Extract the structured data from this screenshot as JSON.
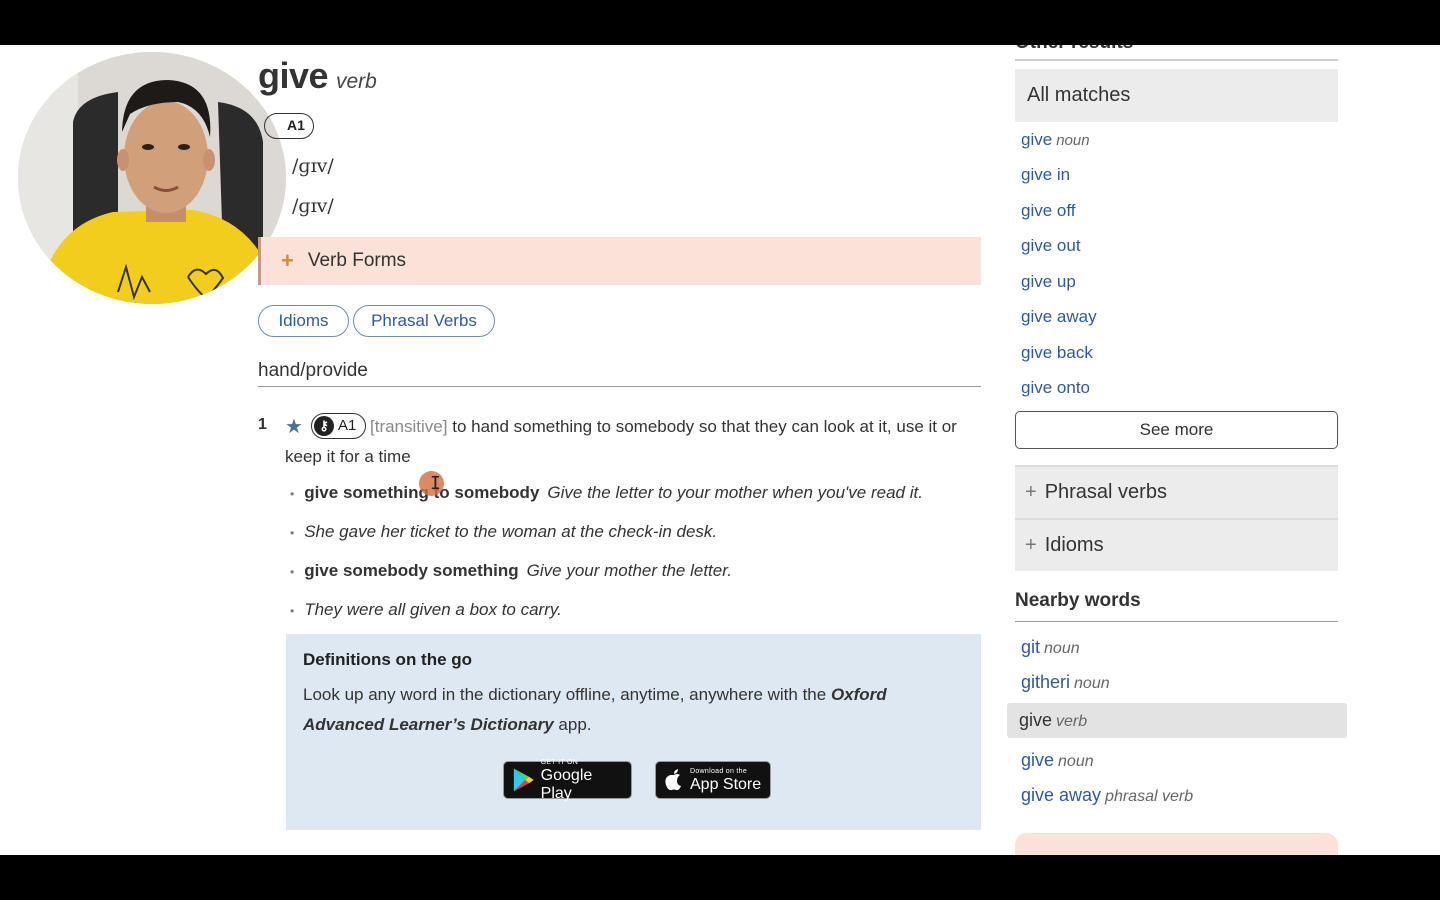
{
  "entry": {
    "headword": "give",
    "pos": "verb",
    "cefr": "A1",
    "phonetic_uk": "/ɡɪv/",
    "phonetic_us": "/ɡɪv/",
    "verb_forms_label": "Verb Forms",
    "tabs": [
      "Idioms",
      "Phrasal Verbs"
    ],
    "sense_heading": "hand/provide",
    "definition": {
      "number": "1",
      "cefr": "A1",
      "grammar": "[transitive]",
      "text": "to hand something to somebody so that they can look at it, use it or keep it for a time"
    },
    "examples": [
      {
        "collocation": "give something to somebody",
        "sentence": "Give the letter to your mother when you've read it."
      },
      {
        "collocation": "",
        "sentence": "She gave her ticket to the woman at the check-in desk."
      },
      {
        "collocation": "give somebody something",
        "sentence": "Give your mother the letter."
      },
      {
        "collocation": "",
        "sentence": "They were all given a box to carry."
      }
    ]
  },
  "promo": {
    "title": "Definitions on the go",
    "body_before": "Look up any word in the dictionary offline, anytime, anywhere with the ",
    "body_emphasis": "Oxford Advanced Learner’s Dictionary",
    "body_after": " app.",
    "google_play_small": "GET IT ON",
    "google_play_big": "Google Play",
    "app_store_small": "Download on the",
    "app_store_big": "App Store"
  },
  "sidebar": {
    "other_results_title": "Other results",
    "all_matches_label": "All matches",
    "matches": [
      {
        "word": "give",
        "pos": "noun"
      },
      {
        "word": "give in",
        "pos": ""
      },
      {
        "word": "give off",
        "pos": ""
      },
      {
        "word": "give out",
        "pos": ""
      },
      {
        "word": "give up",
        "pos": ""
      },
      {
        "word": "give away",
        "pos": ""
      },
      {
        "word": "give back",
        "pos": ""
      },
      {
        "word": "give onto",
        "pos": ""
      }
    ],
    "see_more_label": "See more",
    "phrasal_verbs_label": "Phrasal verbs",
    "idioms_label": "Idioms",
    "nearby_title": "Nearby words",
    "nearby": [
      {
        "word": "git",
        "pos": "noun"
      },
      {
        "word": "githeri",
        "pos": "noun"
      },
      {
        "word": "give",
        "pos": "verb"
      },
      {
        "word": "give",
        "pos": "noun"
      },
      {
        "word": "give away",
        "pos": "phrasal verb"
      }
    ]
  },
  "colors": {
    "link": "#2f5a9a",
    "verb_forms_bg": "#fae2d8",
    "promo_bg": "#dde8f2",
    "star": "#4a6fa5"
  },
  "icons": [
    "oxford-3000-key-icon",
    "star-icon",
    "plus-icon",
    "google-play-icon",
    "apple-icon"
  ]
}
